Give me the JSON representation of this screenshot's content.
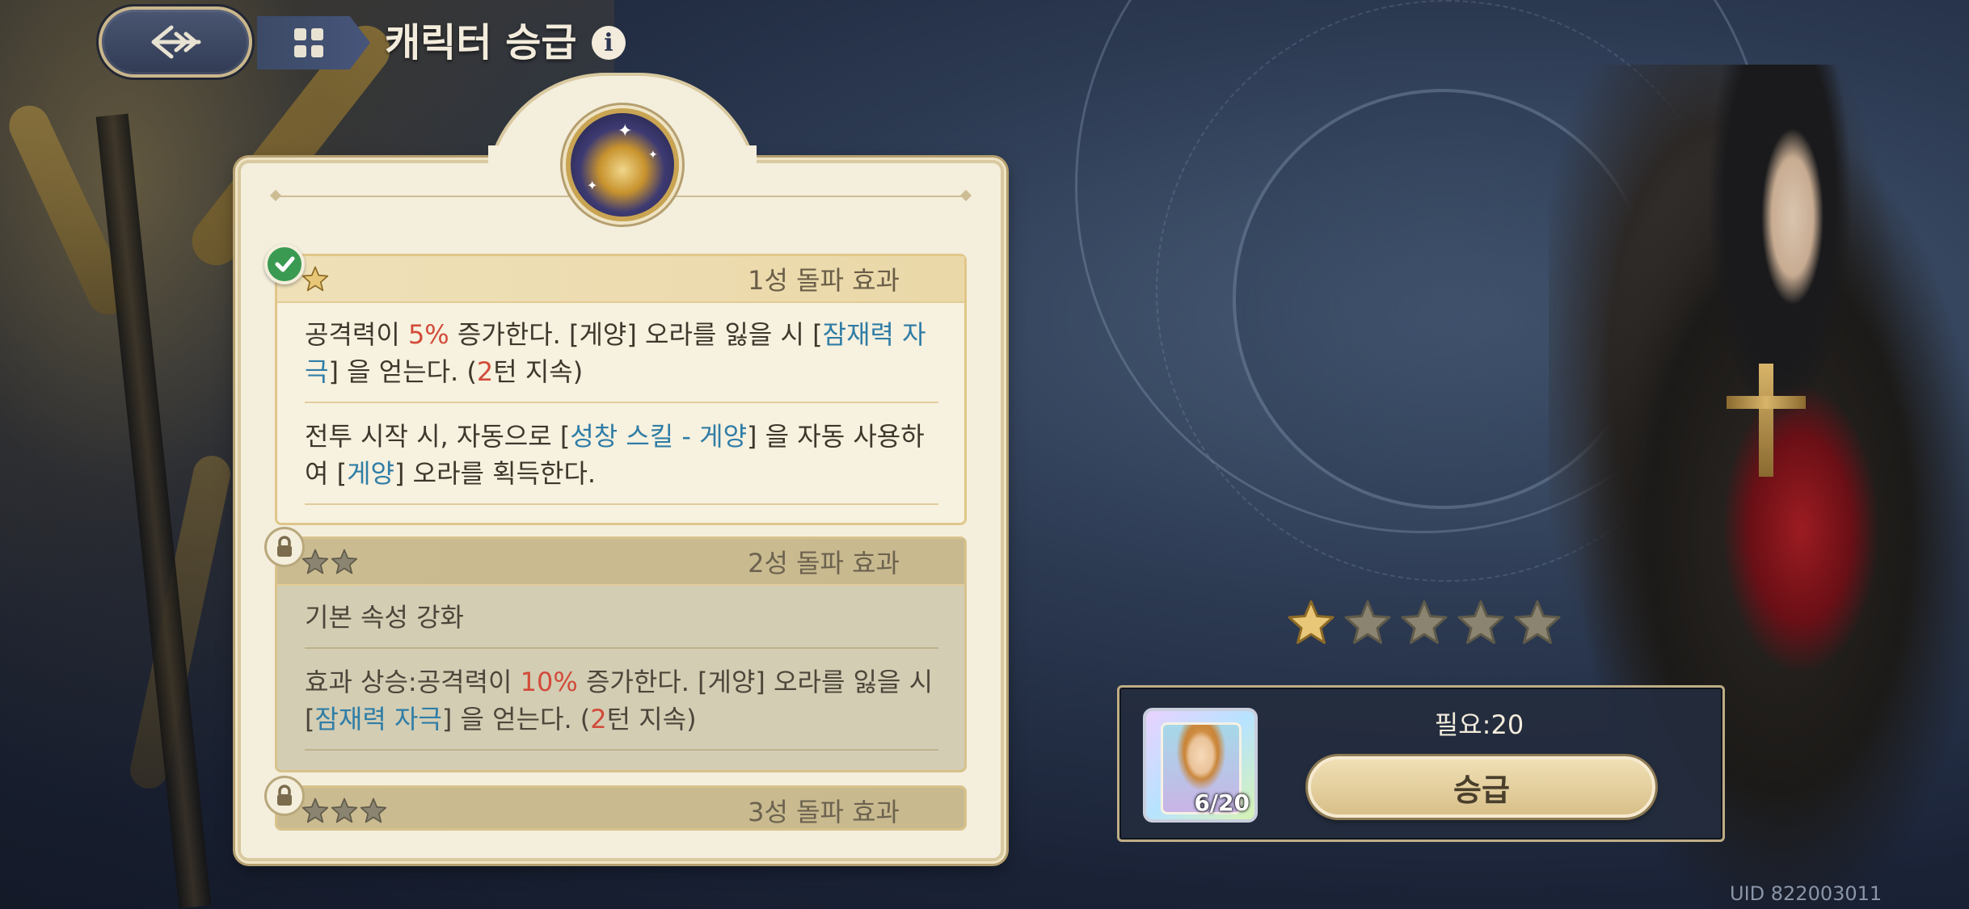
{
  "header": {
    "title": "캐릭터 승급"
  },
  "effects": [
    {
      "title": "1성 돌파 효과",
      "stars": 1,
      "status": "unlocked",
      "lines": [
        [
          {
            "t": "공격력이 ",
            "c": ""
          },
          {
            "t": "5%",
            "c": "red"
          },
          {
            "t": " 증가한다. [게양] 오라를 잃을 시 [",
            "c": ""
          },
          {
            "t": "잠재력 자극",
            "c": "blue"
          },
          {
            "t": "] 을 얻는다. (",
            "c": ""
          },
          {
            "t": "2",
            "c": "red"
          },
          {
            "t": "턴 지속)",
            "c": ""
          }
        ],
        [
          {
            "t": "전투 시작 시, 자동으로 [",
            "c": ""
          },
          {
            "t": "성창 스킬 - 게양",
            "c": "blue"
          },
          {
            "t": "] 을 자동 사용하여 [",
            "c": ""
          },
          {
            "t": "게양",
            "c": "blue"
          },
          {
            "t": "] 오라를 획득한다.",
            "c": ""
          }
        ]
      ]
    },
    {
      "title": "2성 돌파 효과",
      "stars": 2,
      "status": "locked",
      "lines": [
        [
          {
            "t": "기본 속성 강화",
            "c": ""
          }
        ],
        [
          {
            "t": "효과 상승:공격력이 ",
            "c": ""
          },
          {
            "t": "10%",
            "c": "red"
          },
          {
            "t": " 증가한다. [게양] 오라를 잃을 시 [",
            "c": ""
          },
          {
            "t": "잠재력 자극",
            "c": "blue"
          },
          {
            "t": "] 을 얻는다. (",
            "c": ""
          },
          {
            "t": "2",
            "c": "red"
          },
          {
            "t": "턴 지속)",
            "c": ""
          }
        ]
      ]
    },
    {
      "title": "3성 돌파 효과",
      "stars": 3,
      "status": "locked",
      "lines": []
    }
  ],
  "rank": {
    "current_stars": 1,
    "max_stars": 5
  },
  "upgrade": {
    "material_count": "6/20",
    "required_text": "필요:20",
    "button_label": "승급"
  },
  "uid": "UID 822003011",
  "colors": {
    "highlight_red": "#d24b3a",
    "highlight_blue": "#2f7da6",
    "star_gold": "#e8c878",
    "star_empty": "#8a8470",
    "check_green": "#3a9a52"
  },
  "icons": {
    "back": "back-arrow-icon",
    "menu": "grid-menu-icon",
    "info": "info-icon",
    "unlocked": "check-icon",
    "locked": "lock-icon"
  }
}
